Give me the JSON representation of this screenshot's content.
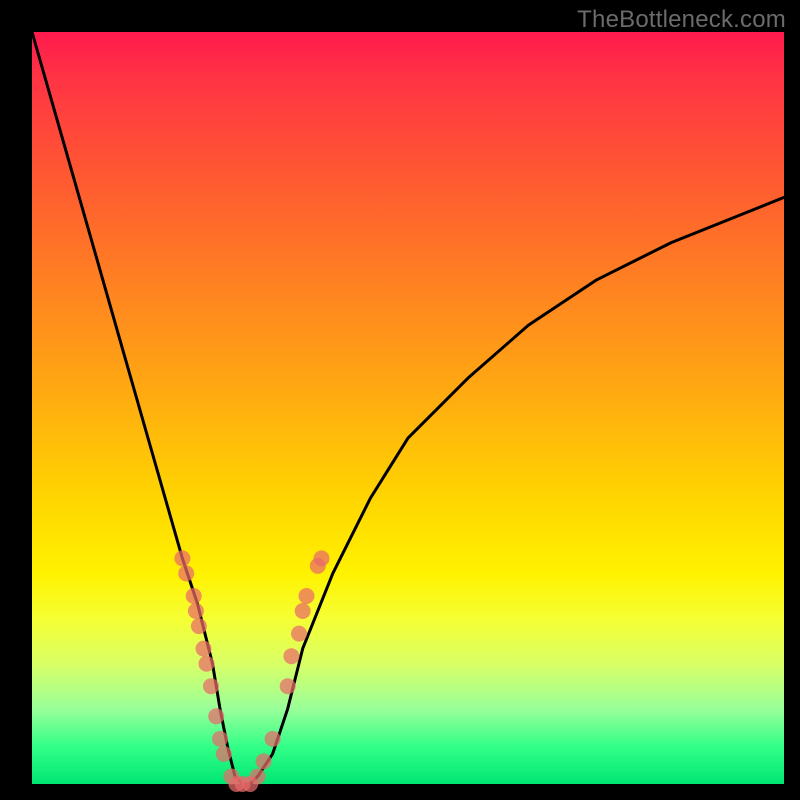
{
  "watermark_text": "TheBottleneck.com",
  "plot": {
    "outer_size": 800,
    "inner_left": 32,
    "inner_top": 32,
    "inner_width": 752,
    "inner_height": 752
  },
  "chart_data": {
    "type": "line",
    "title": "",
    "xlabel": "",
    "ylabel": "",
    "xlim": [
      0,
      100
    ],
    "ylim": [
      0,
      100
    ],
    "legend": false,
    "grid": false,
    "background": "rainbow-vertical-gradient (red→orange→yellow→green)",
    "series": [
      {
        "name": "bottleneck-curve",
        "color": "#000000",
        "x": [
          0,
          4,
          8,
          12,
          16,
          20,
          22,
          24,
          25,
          26,
          27,
          28,
          29,
          30,
          32,
          34,
          36,
          40,
          45,
          50,
          58,
          66,
          75,
          85,
          95,
          100
        ],
        "y": [
          100,
          86,
          72,
          58,
          44,
          30,
          24,
          16,
          10,
          5,
          1,
          0,
          0,
          1,
          4,
          10,
          18,
          28,
          38,
          46,
          54,
          61,
          67,
          72,
          76,
          78
        ]
      }
    ],
    "scatter_overlay": {
      "name": "data-points",
      "color": "#e96a6a",
      "opacity": 0.72,
      "radius": 8,
      "points": [
        {
          "x": 20.0,
          "y": 30
        },
        {
          "x": 20.5,
          "y": 28
        },
        {
          "x": 21.5,
          "y": 25
        },
        {
          "x": 21.8,
          "y": 23
        },
        {
          "x": 22.2,
          "y": 21
        },
        {
          "x": 22.8,
          "y": 18
        },
        {
          "x": 23.2,
          "y": 16
        },
        {
          "x": 23.8,
          "y": 13
        },
        {
          "x": 24.5,
          "y": 9
        },
        {
          "x": 25.0,
          "y": 6
        },
        {
          "x": 25.5,
          "y": 4
        },
        {
          "x": 26.5,
          "y": 1
        },
        {
          "x": 27.2,
          "y": 0
        },
        {
          "x": 28.0,
          "y": 0
        },
        {
          "x": 29.0,
          "y": 0
        },
        {
          "x": 30.0,
          "y": 1
        },
        {
          "x": 30.8,
          "y": 3
        },
        {
          "x": 32.0,
          "y": 6
        },
        {
          "x": 34.0,
          "y": 13
        },
        {
          "x": 34.5,
          "y": 17
        },
        {
          "x": 35.5,
          "y": 20
        },
        {
          "x": 36.0,
          "y": 23
        },
        {
          "x": 36.5,
          "y": 25
        },
        {
          "x": 38.0,
          "y": 29
        },
        {
          "x": 38.5,
          "y": 30
        }
      ]
    }
  }
}
